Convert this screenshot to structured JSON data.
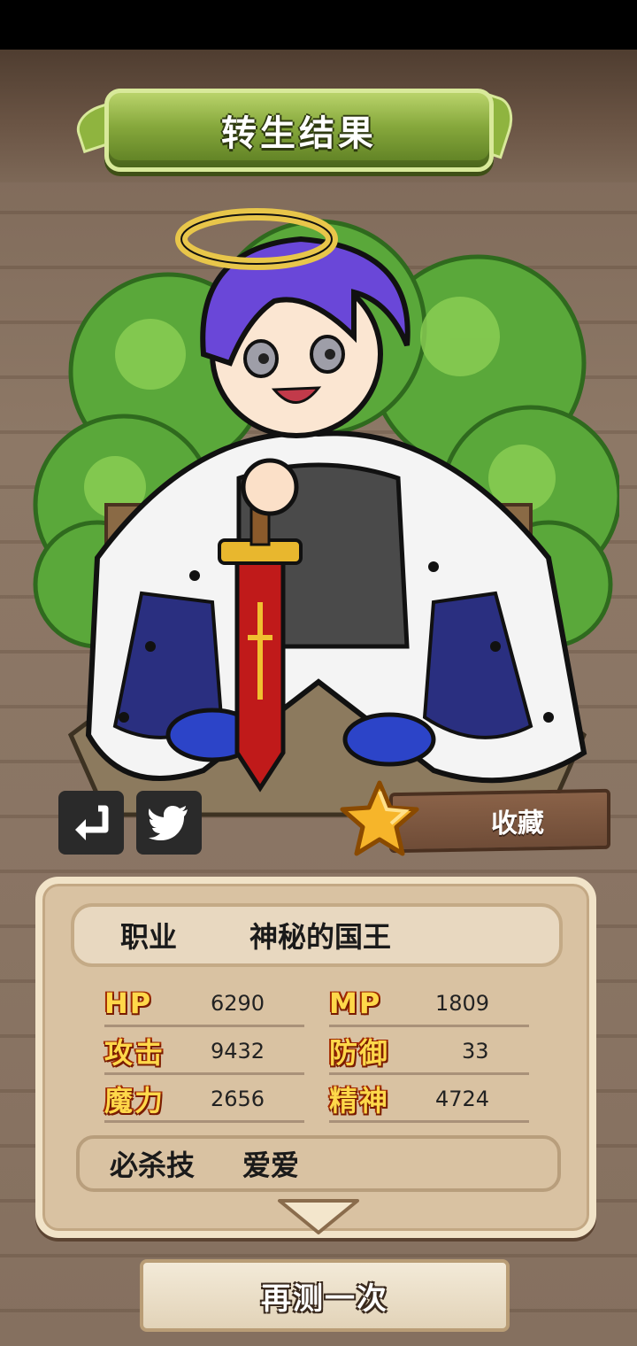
{
  "header": {
    "title": "转生结果"
  },
  "actions": {
    "back_icon": "return-arrow-icon",
    "share_icon": "twitter-bird-icon",
    "favorite_icon": "star-icon",
    "favorite_label": "收藏"
  },
  "result": {
    "class_label": "职业",
    "class_value": "神秘的国王",
    "stats": [
      {
        "label": "HP",
        "value": "6290"
      },
      {
        "label": "MP",
        "value": "1809"
      },
      {
        "label": "攻击",
        "value": "9432"
      },
      {
        "label": "防御",
        "value": "33"
      },
      {
        "label": "魔力",
        "value": "2656"
      },
      {
        "label": "精神",
        "value": "4724"
      }
    ],
    "skill_label": "必杀技",
    "skill_value": "爱爱",
    "expand_icon": "chevron-down-icon"
  },
  "footer": {
    "retry_label": "再测一次"
  },
  "colors": {
    "title_banner": "#86a83c",
    "panel": "#d9c2a2",
    "stat_label": "#ffd84a",
    "background": "#8a7462"
  }
}
